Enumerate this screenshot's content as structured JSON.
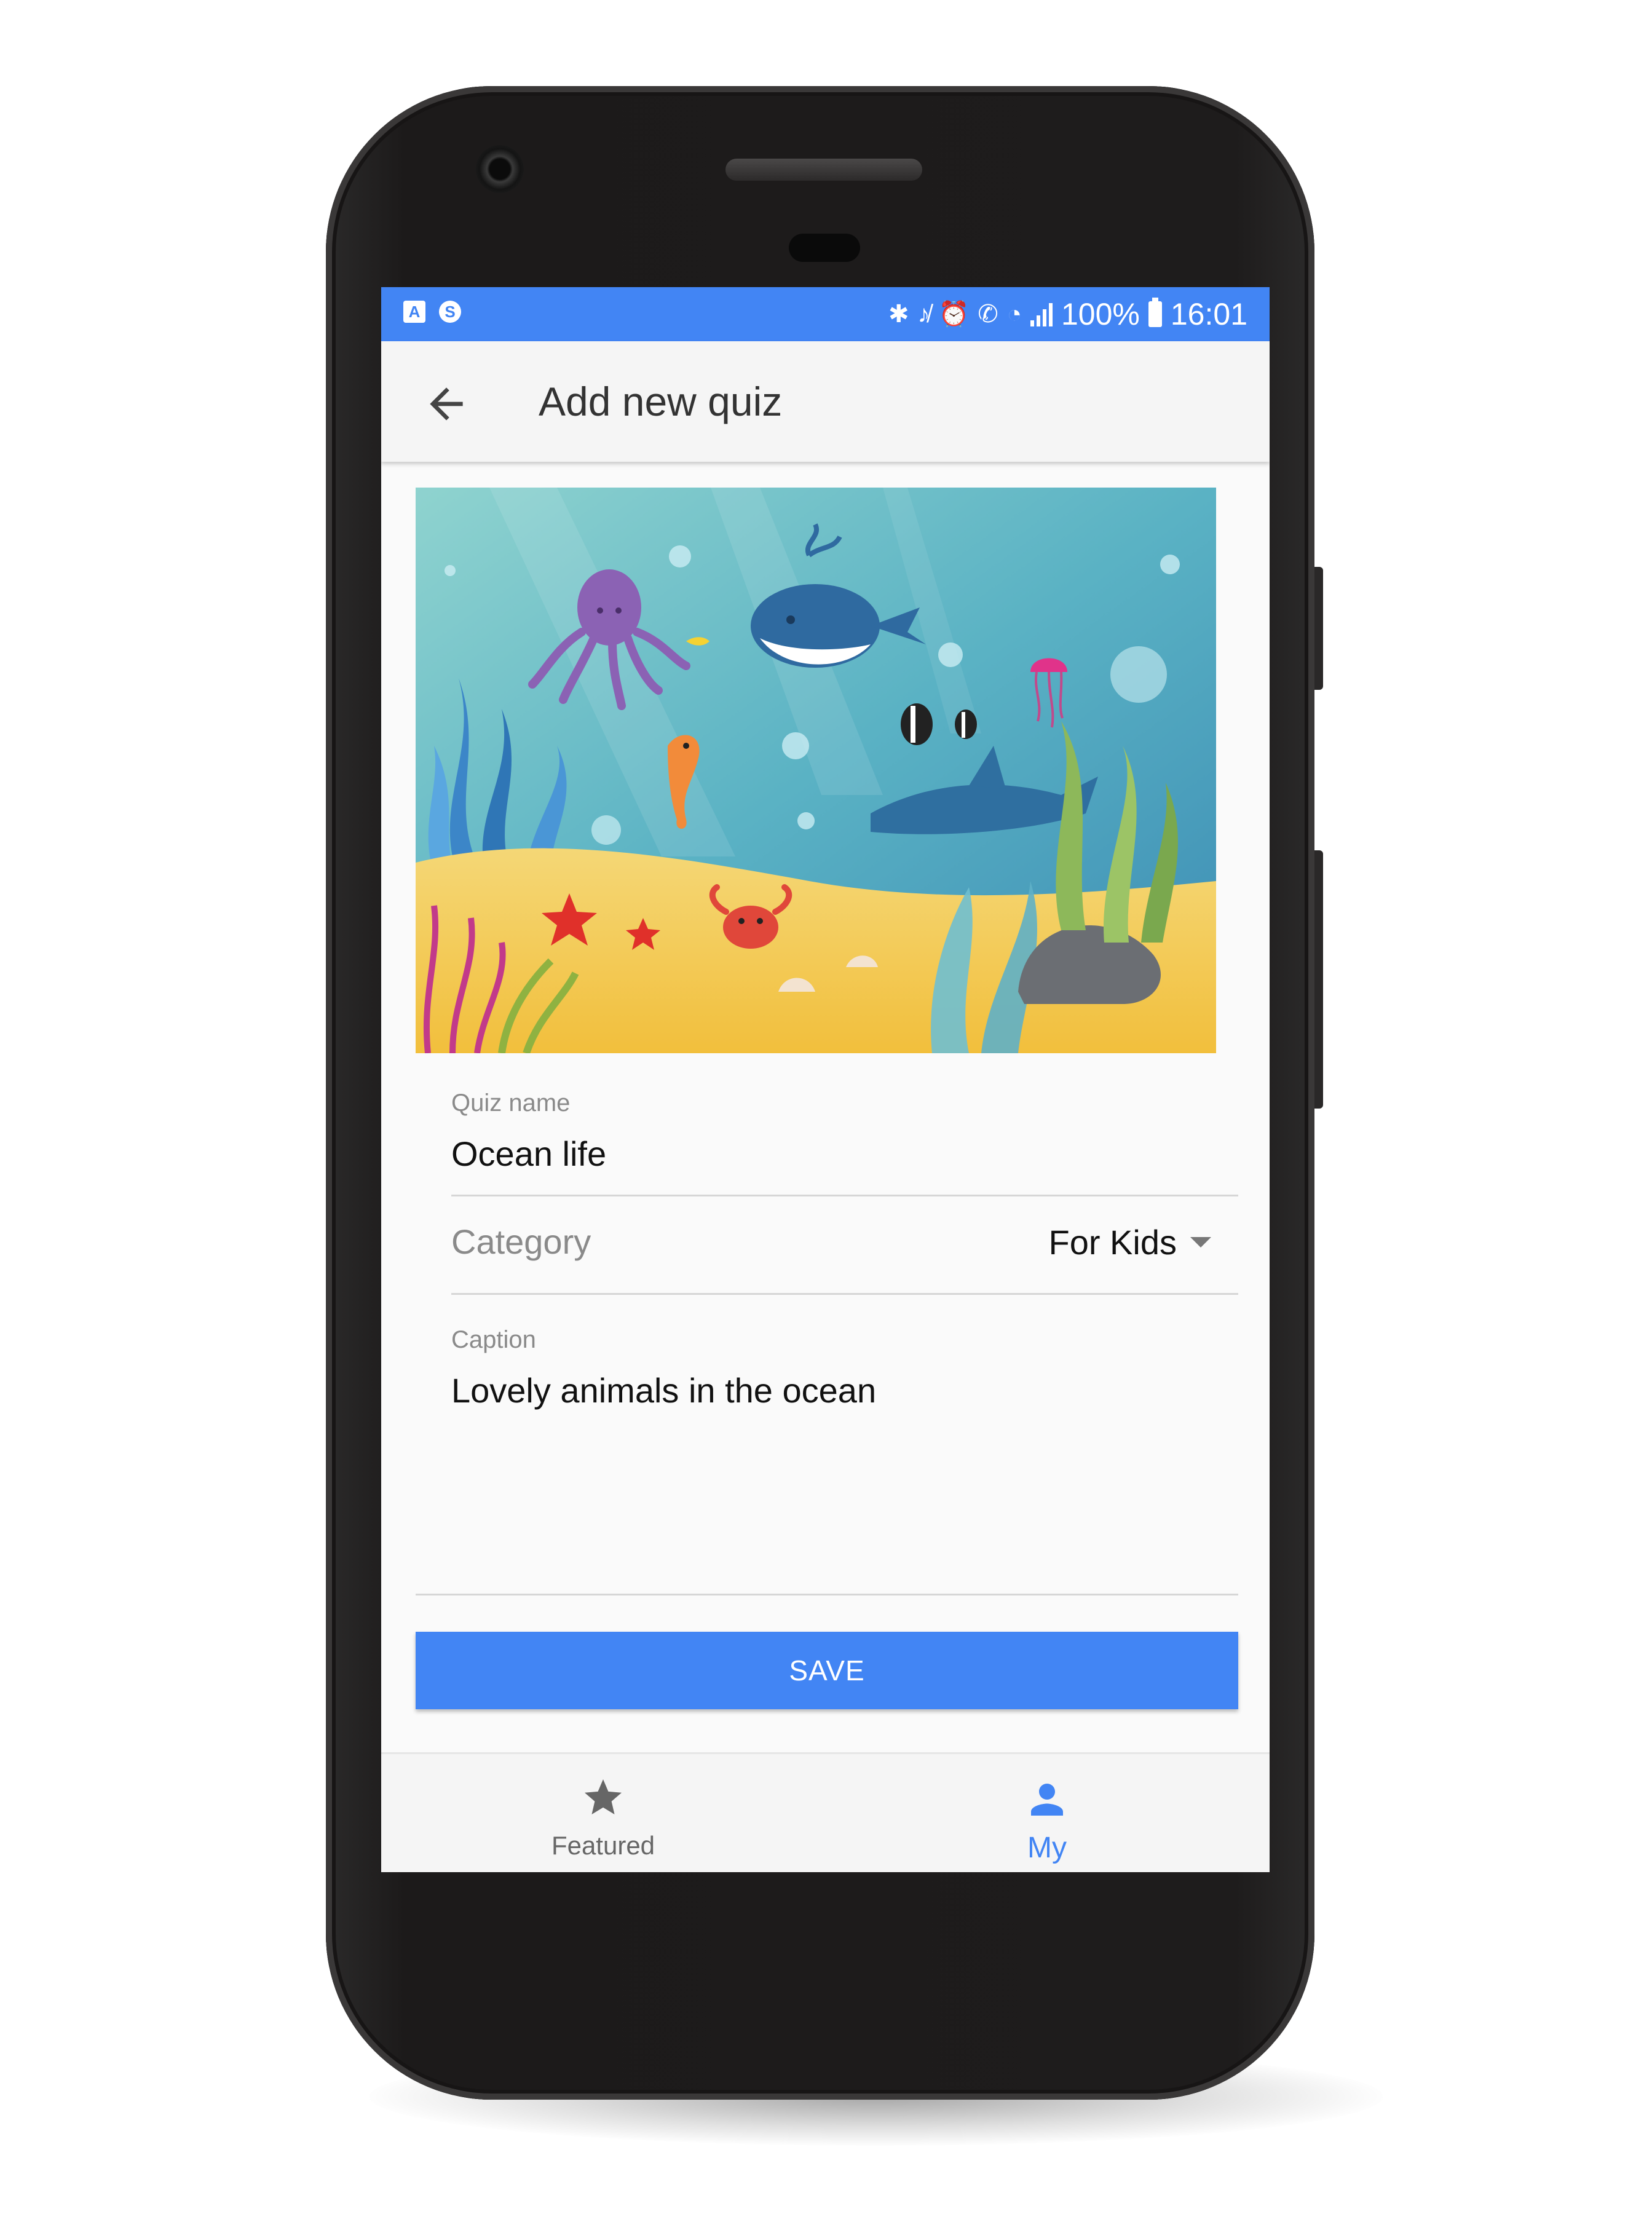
{
  "status_bar": {
    "battery": "100%",
    "time": "16:01",
    "left_icons": [
      "app-a-icon",
      "app-s-icon"
    ],
    "right_icons": [
      "bluetooth-icon",
      "mute-icon",
      "alarm-icon",
      "call-icon",
      "wifi-icon",
      "signal-icon",
      "battery-icon"
    ],
    "app_a_letter": "A",
    "app_s_letter": "S"
  },
  "app_bar": {
    "title": "Add new quiz",
    "back_icon": "arrow-back-icon"
  },
  "quiz_image": {
    "subject": "ocean-illustration"
  },
  "form": {
    "quiz_name": {
      "label": "Quiz name",
      "value": "Ocean life"
    },
    "category": {
      "label": "Category",
      "value": "For Kids"
    },
    "caption": {
      "label": "Caption",
      "value": "Lovely animals in the ocean"
    },
    "save_label": "SAVE"
  },
  "bottom_nav": {
    "items": [
      {
        "label": "Featured",
        "icon": "star-icon",
        "active": false
      },
      {
        "label": "My",
        "icon": "person-icon",
        "active": true
      }
    ]
  },
  "colors": {
    "accent": "#4285f4",
    "inactive": "#666666",
    "phone_body": "#1e1c1c"
  }
}
